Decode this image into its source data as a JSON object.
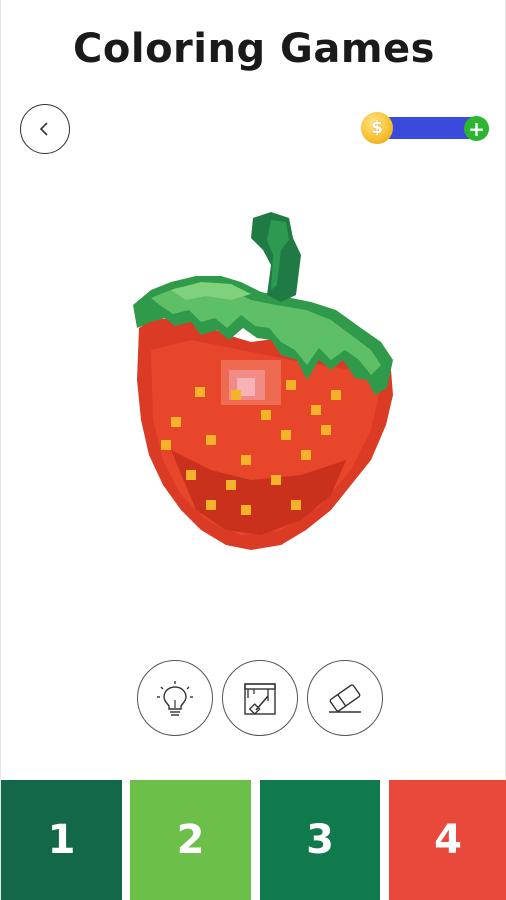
{
  "header": {
    "title": "Coloring Games"
  },
  "coins": {
    "icon": "dollar-coin-icon",
    "symbol": "$",
    "add_icon": "plus-icon",
    "add_label": "+"
  },
  "tools": [
    {
      "name": "hint",
      "icon": "lightbulb-icon"
    },
    {
      "name": "fill",
      "icon": "paint-bucket-icon"
    },
    {
      "name": "eraser",
      "icon": "eraser-icon"
    }
  ],
  "palette": [
    {
      "number": "1",
      "color": "#14684a"
    },
    {
      "number": "2",
      "color": "#6cc04a"
    },
    {
      "number": "3",
      "color": "#117a4d"
    },
    {
      "number": "4",
      "color": "#e9493a"
    }
  ],
  "colors": {
    "coin_track": "#3a4bdb",
    "add_button": "#2bb531"
  }
}
